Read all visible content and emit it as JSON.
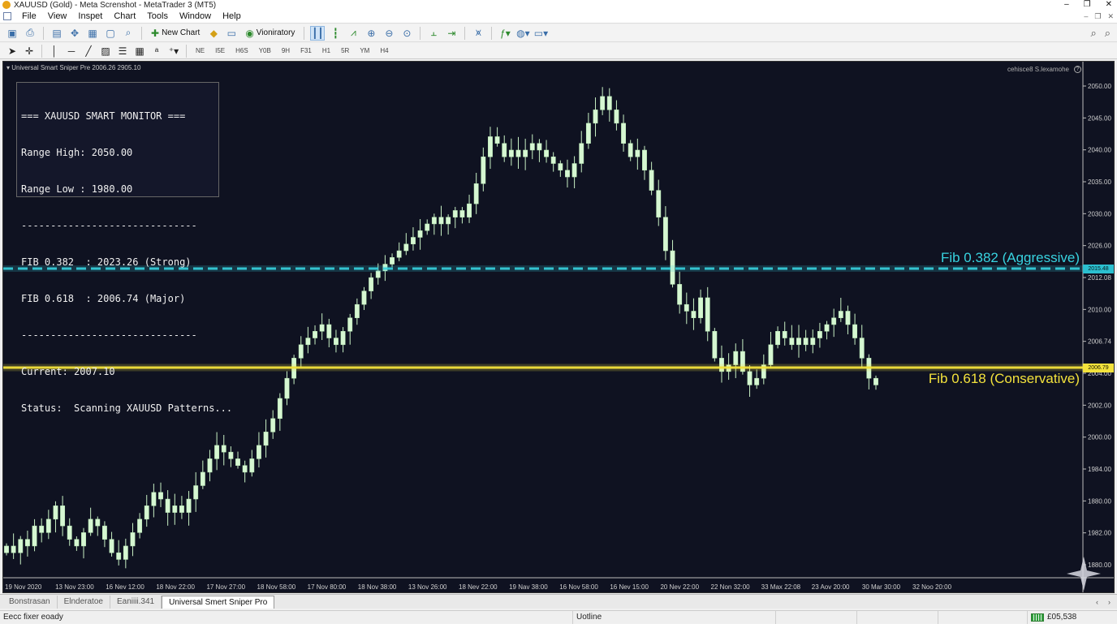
{
  "window": {
    "title": "XAUUSD (Gold) - Meta Screnshot - MetaTrader 3 (MT5)",
    "controls": [
      "–",
      "❐",
      "✕"
    ]
  },
  "menu": [
    "File",
    "View",
    "Inspet",
    "Chart",
    "Tools",
    "Window",
    "Help"
  ],
  "toolbar": {
    "new_chart_label": "New Chart",
    "history_label": "Vioniratory"
  },
  "timeframes": [
    "NE",
    "I5E",
    "H6S",
    "Y0B",
    "9H",
    "F31",
    "H1",
    "5R",
    "YM",
    "H4"
  ],
  "chart_header": {
    "indicator": "Universal Smart Sniper Pre  2006.26 2905.10",
    "right_text": "cehisce8 S.lexamohe",
    "help_glyph": "?"
  },
  "monitor": {
    "lines": [
      "=== XAUUSD SMART MONITOR ===",
      "Range High: 2050.00",
      "Range Low : 1980.00",
      "------------------------------",
      "FIB 0.382  : 2023.26 (Strong)",
      "FIB 0.618  : 2006.74 (Major)",
      "------------------------------",
      "Current: 2007.10",
      "Status:  Scanning XAUUSD Patterns..."
    ]
  },
  "fib_levels": {
    "aggressive_label": "Fib 0.382 (Aggressive)",
    "aggressive_tag": "2015.48",
    "aggressive_color": "#38d3e0",
    "conservative_label": "Fib 0.618 (Conservative)",
    "conservative_tag": "2006.79",
    "conservative_color": "#f3e23c"
  },
  "chart_data": {
    "type": "candlestick",
    "y_axis_labels": [
      "2050.00",
      "2045.00",
      "2040.00",
      "2035.00",
      "2030.00",
      "2026.00",
      "2012.08",
      "2010.00",
      "2006.74",
      "2004.00",
      "2002.00",
      "2000.00",
      "1984.00",
      "1880.00",
      "1982.00",
      "1880.00"
    ],
    "x_axis_labels": [
      "19 Nov 2020",
      "13 Nov 23:00",
      "16 Nev 12:00",
      "18 Nov 22:00",
      "17 Nov 27:00",
      "18 Nov 58:00",
      "17 Nov 80:00",
      "18 Nov 38:00",
      "13 Nov 26:00",
      "18 Nev 22:00",
      "19 Nav 38:00",
      "16 Nov 58:00",
      "16 Nev 15:00",
      "20 Nev 22:00",
      "22 Non 32:00",
      "33 Max 22:08",
      "23 Aov 20:00",
      "30 Mar 30:00",
      "32 Noo 20:00"
    ],
    "closes": [
      1982,
      1981,
      1983,
      1982,
      1985,
      1984,
      1986,
      1988,
      1985,
      1983,
      1982,
      1984,
      1986,
      1985,
      1983,
      1981,
      1980,
      1982,
      1984,
      1986,
      1988,
      1990,
      1989,
      1987,
      1988,
      1987,
      1989,
      1991,
      1993,
      1995,
      1997,
      1996,
      1995,
      1994,
      1993,
      1995,
      1997,
      1999,
      2001,
      2004,
      2007,
      2010,
      2012,
      2013,
      2014,
      2015,
      2013,
      2012,
      2014,
      2016,
      2018,
      2020,
      2022,
      2023,
      2024,
      2025,
      2026,
      2027,
      2028,
      2029,
      2030,
      2031,
      2030,
      2031,
      2032,
      2031,
      2033,
      2036,
      2040,
      2043,
      2042,
      2040,
      2041,
      2040,
      2041,
      2042,
      2041,
      2040,
      2039,
      2038,
      2037,
      2039,
      2042,
      2045,
      2047,
      2049,
      2047,
      2045,
      2042,
      2040,
      2041,
      2038,
      2035,
      2031,
      2026,
      2021,
      2018,
      2017,
      2016,
      2019,
      2014,
      2010,
      2008,
      2009,
      2011,
      2008,
      2006,
      2007,
      2009,
      2012,
      2014,
      2013,
      2012,
      2013,
      2012,
      2013,
      2014,
      2015,
      2016,
      2017,
      2015,
      2013,
      2010,
      2007,
      2006
    ],
    "hlines": [
      2015.48,
      2006.79
    ],
    "ylim": [
      1978,
      2052
    ]
  },
  "tabs": [
    "Bonstrasan",
    "Elnderatoe",
    "Eaniiii.341",
    "Universal Smert Sniper Pro"
  ],
  "tab_nav": [
    "‹",
    "›"
  ],
  "status": {
    "left": "Eecc fixer eoady",
    "middle": "Uotline",
    "right": "£05,538"
  }
}
